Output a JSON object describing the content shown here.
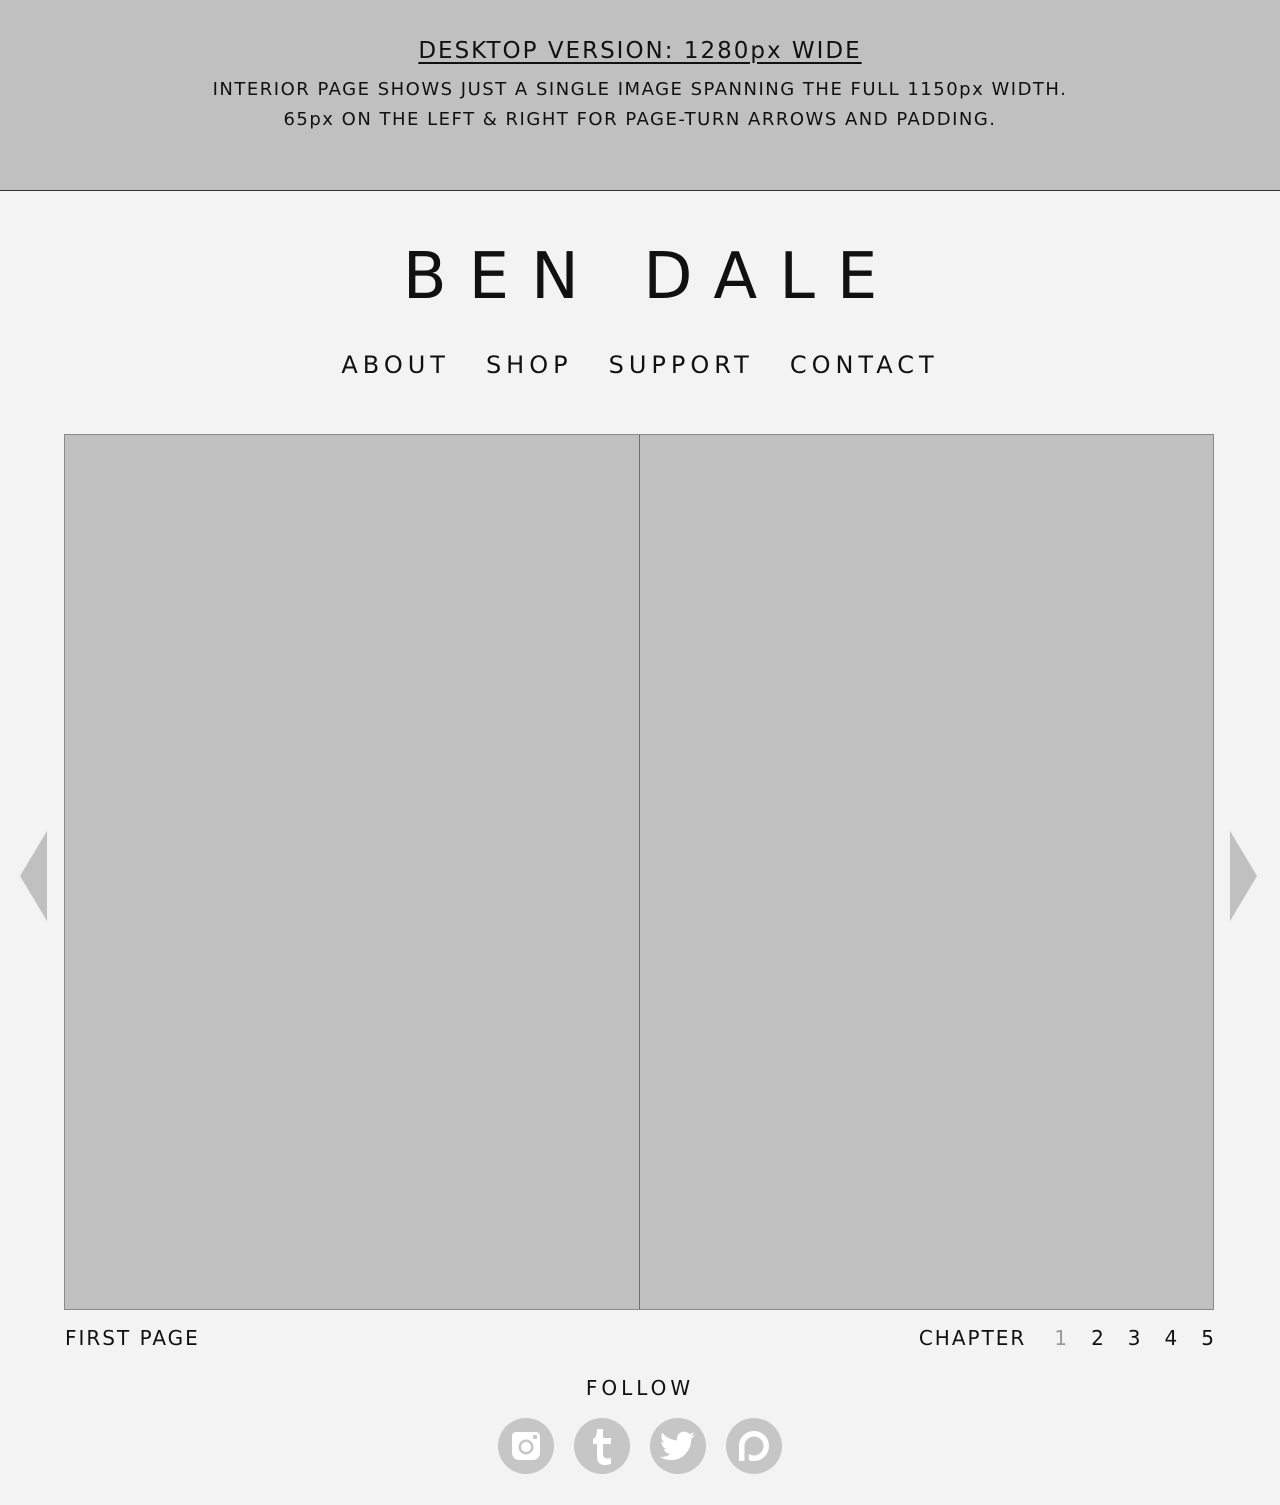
{
  "note": {
    "title": "DESKTOP VERSION: 1280px WIDE",
    "line1": "INTERIOR PAGE SHOWS JUST A SINGLE IMAGE SPANNING THE FULL 1150px WIDTH.",
    "line2": "65px ON THE LEFT & RIGHT FOR PAGE-TURN ARROWS AND PADDING."
  },
  "site": {
    "logo": "BEN DALE"
  },
  "nav": {
    "items": [
      {
        "label": "ABOUT"
      },
      {
        "label": "SHOP"
      },
      {
        "label": "SUPPORT"
      },
      {
        "label": "CONTACT"
      }
    ]
  },
  "reader": {
    "prev_icon": "chevron-left-triangle-icon",
    "next_icon": "chevron-right-triangle-icon",
    "first_page_label": "FIRST PAGE",
    "chapter_label": "CHAPTER",
    "chapters": [
      "1",
      "2",
      "3",
      "4",
      "5"
    ],
    "current_chapter": "1"
  },
  "footer": {
    "follow_label": "FOLLOW",
    "socials": [
      {
        "icon": "instagram-icon"
      },
      {
        "icon": "tumblr-icon"
      },
      {
        "icon": "twitter-icon"
      },
      {
        "icon": "patreon-icon"
      }
    ]
  },
  "colors": {
    "page_background": "#f3f3f3",
    "placeholder_gray": "#c0c0c0",
    "icon_gray": "#c6c6c6",
    "current_chapter": "#9a9a9a",
    "text": "#111111"
  }
}
